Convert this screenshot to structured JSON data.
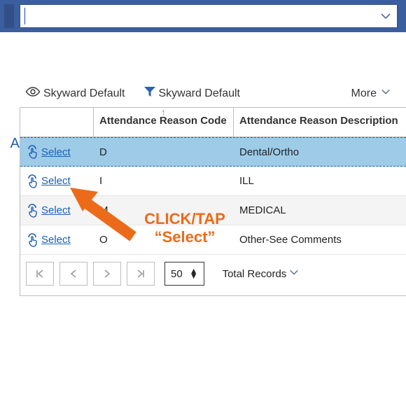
{
  "search": {
    "value": "",
    "placeholder": ""
  },
  "filters": {
    "view_label": "Skyward Default",
    "funnel_label": "Skyward Default",
    "more_label": "More"
  },
  "left_stub": "A",
  "table": {
    "headers": {
      "code": "Attendance Reason Code",
      "desc": "Attendance Reason Description"
    },
    "rows": [
      {
        "select_label": "Select",
        "code": "D",
        "desc": "Dental/Ortho",
        "selected": true
      },
      {
        "select_label": "Select",
        "code": "I",
        "desc": "ILL"
      },
      {
        "select_label": "Select",
        "code": "M",
        "desc": "MEDICAL"
      },
      {
        "select_label": "Select",
        "code": "O",
        "desc": "Other-See Comments"
      }
    ]
  },
  "pager": {
    "page_size": "50",
    "total_label": "Total Records"
  },
  "annotation": {
    "line1": "CLICK/TAP",
    "line2": "“Select”"
  }
}
